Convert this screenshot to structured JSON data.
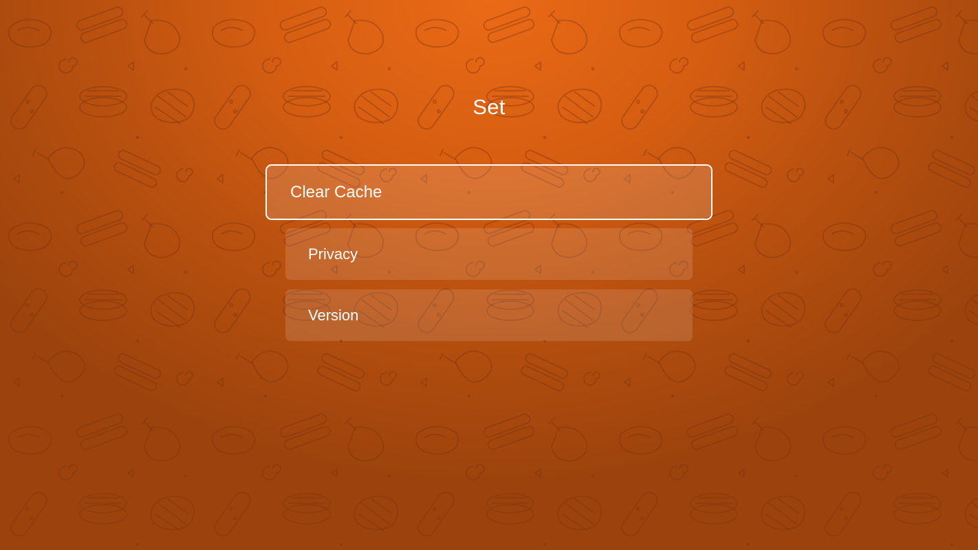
{
  "screen": {
    "title": "Set",
    "background_color": "#d65e12",
    "background_pattern": "food-doodle-pattern"
  },
  "menu": {
    "items": [
      {
        "label": "Clear Cache",
        "focused": true
      },
      {
        "label": "Privacy",
        "focused": false
      },
      {
        "label": "Version",
        "focused": false
      }
    ]
  }
}
